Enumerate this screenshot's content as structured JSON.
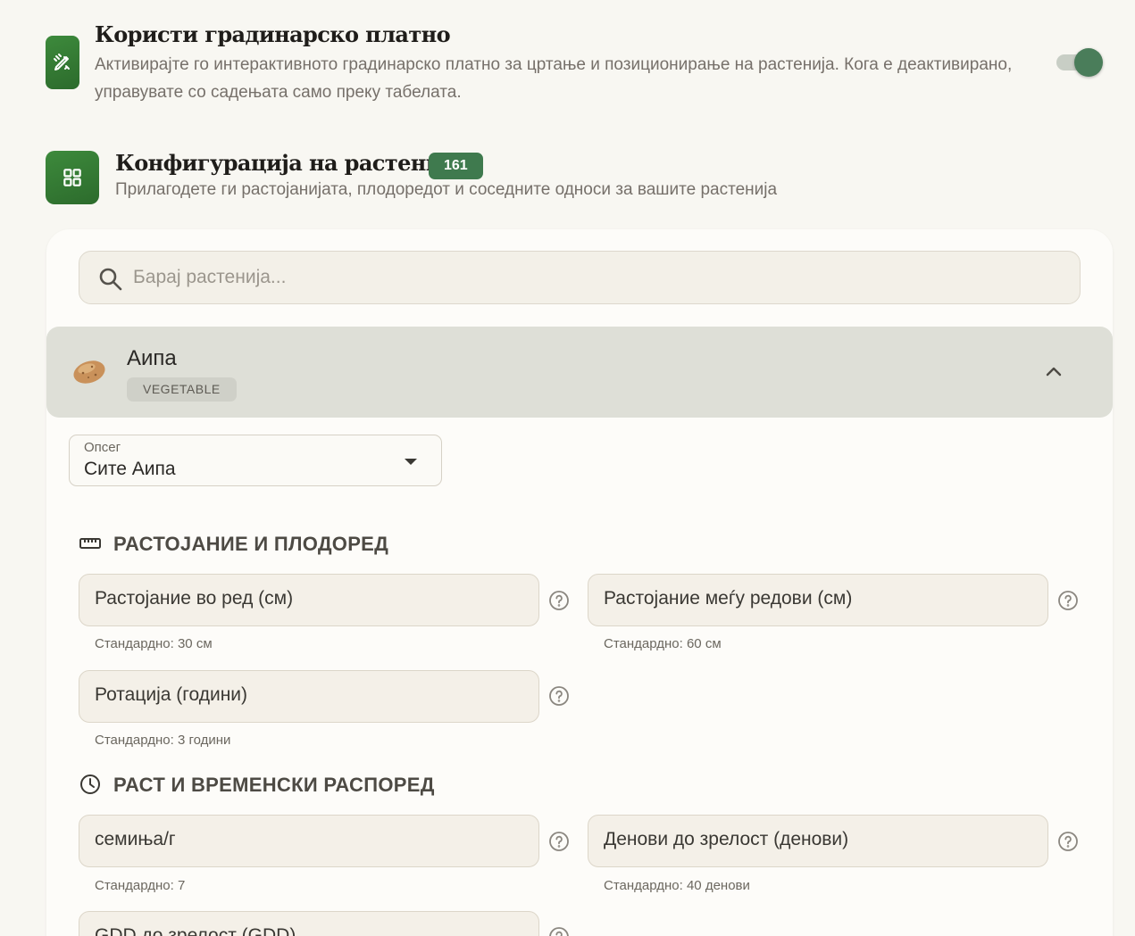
{
  "canvas_setting": {
    "title": "Користи градинарско платно",
    "description": "Активирајте го интерактивното градинарско платно за цртање и позиционирање на растенија. Кога е деактивирано, управувате со садењата само преку табелата.",
    "icon": "pencil-ruler-icon",
    "enabled": true
  },
  "plant_config": {
    "title": "Конфигурација на растенија",
    "count": "161",
    "description": "Прилагодете ги растојанијата, плодоредот и соседните односи за вашите растенија",
    "icon": "grid-icon"
  },
  "search": {
    "placeholder": "Барај растенија..."
  },
  "plant": {
    "name": "Аипа",
    "category": "VEGETABLE",
    "emoji": "potato",
    "expanded": true
  },
  "variety_select": {
    "label": "Опсег",
    "value": "Сите Аипа"
  },
  "groups": {
    "spacing": {
      "title": "РАСТОЈАНИЕ И ПЛОДОРЕД",
      "icon": "ruler-icon",
      "fields": [
        {
          "label": "Растојание во ред (см)",
          "hint": "Стандардно: 30 см"
        },
        {
          "label": "Растојание меѓу редови (см)",
          "hint": "Стандардно: 60 см"
        },
        {
          "label": "Ротација (години)",
          "hint": "Стандардно: 3 години"
        }
      ]
    },
    "growth": {
      "title": "РАСТ И ВРЕМЕНСКИ РАСПОРЕД",
      "icon": "clock-icon",
      "fields": [
        {
          "label": "семиња/г",
          "hint": "Стандардно: 7"
        },
        {
          "label": "Денови до зрелост (денови)",
          "hint": "Стандардно: 40 денови"
        },
        {
          "label": "GDD до зрелост (GDD)"
        }
      ]
    }
  },
  "colors": {
    "accent": "#3f7a4e",
    "background": "#f8f7f2",
    "card": "#fdfcf9"
  }
}
